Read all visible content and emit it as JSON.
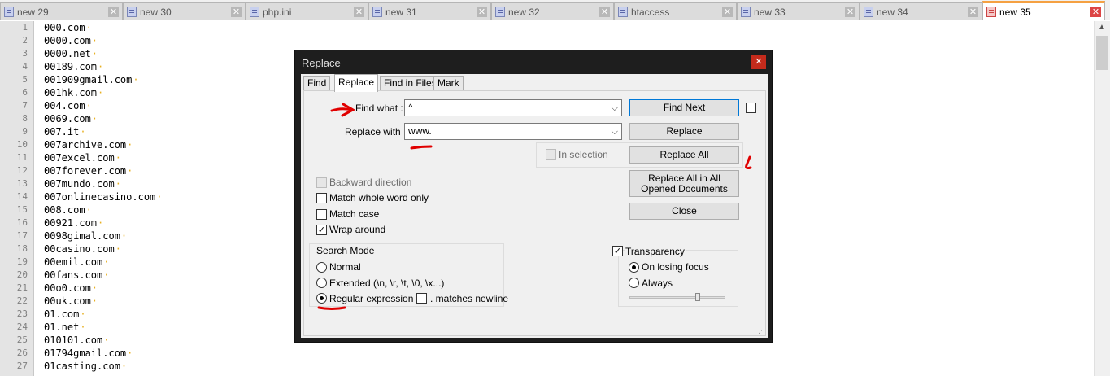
{
  "tabs": [
    {
      "label": "new 29"
    },
    {
      "label": "new 30"
    },
    {
      "label": "php.ini"
    },
    {
      "label": "new 31"
    },
    {
      "label": "new 32"
    },
    {
      "label": "htaccess"
    },
    {
      "label": "new 33"
    },
    {
      "label": "new 34"
    },
    {
      "label": "new 35",
      "active": true
    }
  ],
  "tab_close_glyph": "✕",
  "editor": {
    "lines": [
      {
        "n": "1",
        "text": "000.com"
      },
      {
        "n": "2",
        "text": "0000.com"
      },
      {
        "n": "3",
        "text": "0000.net"
      },
      {
        "n": "4",
        "text": "00189.com"
      },
      {
        "n": "5",
        "text": "001909gmail.com"
      },
      {
        "n": "6",
        "text": "001hk.com"
      },
      {
        "n": "7",
        "text": "004.com"
      },
      {
        "n": "8",
        "text": "0069.com"
      },
      {
        "n": "9",
        "text": "007.it"
      },
      {
        "n": "10",
        "text": "007archive.com"
      },
      {
        "n": "11",
        "text": "007excel.com"
      },
      {
        "n": "12",
        "text": "007forever.com"
      },
      {
        "n": "13",
        "text": "007mundo.com"
      },
      {
        "n": "14",
        "text": "007onlinecasino.com"
      },
      {
        "n": "15",
        "text": "008.com"
      },
      {
        "n": "16",
        "text": "00921.com"
      },
      {
        "n": "17",
        "text": "0098gimal.com"
      },
      {
        "n": "18",
        "text": "00casino.com"
      },
      {
        "n": "19",
        "text": "00emil.com"
      },
      {
        "n": "20",
        "text": "00fans.com"
      },
      {
        "n": "21",
        "text": "00o0.com"
      },
      {
        "n": "22",
        "text": "00uk.com"
      },
      {
        "n": "23",
        "text": "01.com"
      },
      {
        "n": "24",
        "text": "01.net"
      },
      {
        "n": "25",
        "text": "010101.com"
      },
      {
        "n": "26",
        "text": "01794gmail.com"
      },
      {
        "n": "27",
        "text": "01casting.com"
      }
    ],
    "eol_marker": "·"
  },
  "dialog": {
    "title": "Replace",
    "close_glyph": "✕",
    "tabs": {
      "find": "Find",
      "replace": "Replace",
      "find_in_files": "Find in Files",
      "mark": "Mark"
    },
    "find_what": {
      "label": "Find what :",
      "value": "^"
    },
    "replace_with": {
      "label": "Replace with :",
      "value": "www."
    },
    "buttons": {
      "find_next": "Find Next",
      "replace": "Replace",
      "replace_all": "Replace All",
      "replace_all_opened": "Replace All in All Opened Documents",
      "close": "Close"
    },
    "in_selection": "In selection",
    "options": {
      "backward": "Backward direction",
      "whole_word": "Match whole word only",
      "match_case": "Match case",
      "wrap_around": "Wrap around"
    },
    "search_mode": {
      "title": "Search Mode",
      "normal": "Normal",
      "extended": "Extended (\\n, \\r, \\t, \\0, \\x...)",
      "regex": "Regular expression",
      "matches_newline": ". matches newline",
      "selected": "regex"
    },
    "transparency": {
      "title": "Transparency",
      "on_losing_focus": "On losing focus",
      "always": "Always",
      "selected": "on_losing_focus"
    },
    "check_glyph": "✓",
    "combo_arrow": "⌵",
    "grip": "⋰"
  },
  "colors": {
    "annotation": "#e00000",
    "active_tab_accent": "#f5a142",
    "close_red": "#c42b1c"
  }
}
